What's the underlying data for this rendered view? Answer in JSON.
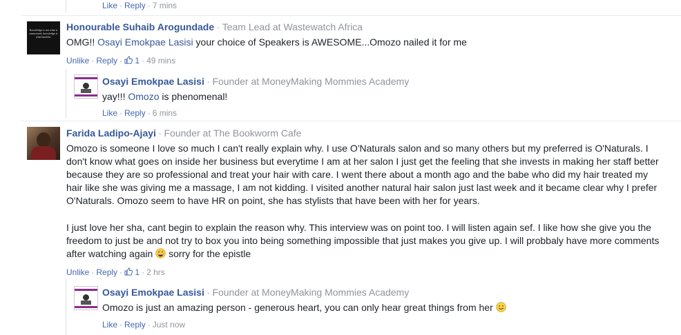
{
  "top_actions": {
    "like": "Like",
    "reply": "Reply",
    "time": "7 mins"
  },
  "comments": [
    {
      "name": "Honourable Suhaib Arogundade",
      "title": "Team Lead at Wastewatch Africa",
      "avatar_text": "Knowledge is not what is memorised, knowledge is what benefits.",
      "text_before": "OMG!! ",
      "mention": "Osayi Emokpae Lasisi",
      "text_after": " your choice of Speakers is AWESOME...Omozo nailed it for me",
      "actions": {
        "unlike": "Unlike",
        "reply": "Reply",
        "likes": "1",
        "time": "49 mins"
      },
      "reply": {
        "name": "Osayi Emokpae Lasisi",
        "title": "Founder at MoneyMaking Mommies Academy",
        "text_before": "yay!!! ",
        "mention": "Omozo",
        "text_after": " is phenomenal!",
        "actions": {
          "like": "Like",
          "reply": "Reply",
          "time": "6 mins"
        }
      }
    },
    {
      "name": "Farida Ladipo-Ajayi",
      "title": "Founder at The Bookworm Cafe",
      "paragraph1": "Omozo is someone I love so much I can't really explain why. I use O'Naturals salon and so many others but my preferred is O'Naturals. I don't know what goes on inside her business but everytime I am at her salon I just get the feeling that she invests in making her staff better because they are so professional and treat your hair with care. I went there about a month ago and the babe who did my hair treated my hair like she was giving me a massage, I am not kidding. I visited another natural hair salon just last week and it became clear why I prefer O'Naturals. Omozo seem to have HR on point, she has stylists that have been with her for years.",
      "paragraph2_before": "I just love her sha, cant begin to explain the reason why. This interview was on point too. I will listen again sef. I like how she give you the freedom to just be and not try to box you into being something impossible that just makes you give up. I will probbaly have more comments after watching again ",
      "paragraph2_after": " sorry for the epistle",
      "actions": {
        "unlike": "Unlike",
        "reply": "Reply",
        "likes": "1",
        "time": "2 hrs"
      },
      "reply": {
        "name": "Osayi Emokpae Lasisi",
        "title": "Founder at MoneyMaking Mommies Academy",
        "text": "Omozo is just an amazing person - generous heart, you can only hear great things from her ",
        "actions": {
          "like": "Like",
          "reply": "Reply",
          "time": "Just now"
        }
      }
    }
  ],
  "colors": {
    "link": "#365899",
    "action": "#4267b2",
    "meta": "#90949c",
    "text": "#1d2129"
  }
}
